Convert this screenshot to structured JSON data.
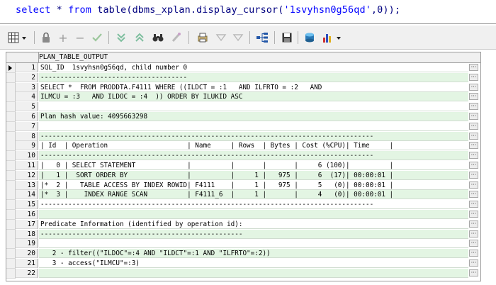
{
  "editor": {
    "kw_select": "select",
    "star": " * ",
    "kw_from": "from",
    "call_prefix": " table(dbms_xplan.display_cursor(",
    "str_sqlid": "'1svyhsn0g56qd'",
    "call_suffix": ",0));"
  },
  "toolbar": {
    "icons": [
      "grid-select-icon",
      "lock-icon",
      "add-icon",
      "remove-icon",
      "post-icon",
      "sort-down-icon",
      "sort-up-icon",
      "find-icon",
      "clear-icon",
      "print-icon",
      "filter-icon",
      "filter-clear-icon",
      "tree-icon",
      "save-icon",
      "database-icon",
      "chart-icon"
    ],
    "colors": {
      "icon_gray": "#7d7d7d",
      "icon_blue": "#2458a8",
      "icon_green": "#3a9a3a"
    }
  },
  "grid": {
    "column_header": "PLAN_TABLE_OUTPUT",
    "more_label": "···",
    "rows": [
      {
        "n": "1",
        "text": "SQL_ID  1svyhsn0g56qd, child number 0"
      },
      {
        "n": "2",
        "text": "-------------------------------------"
      },
      {
        "n": "3",
        "text": "SELECT *  FROM PRODDTA.F4111 WHERE ((ILDCT = :1   AND ILFRTO = :2   AND"
      },
      {
        "n": "4",
        "text": "ILMCU = :3   AND ILDOC = :4  )) ORDER BY ILUKID ASC"
      },
      {
        "n": "5",
        "text": ""
      },
      {
        "n": "6",
        "text": "Plan hash value: 4095663298"
      },
      {
        "n": "7",
        "text": ""
      },
      {
        "n": "8",
        "text": "------------------------------------------------------------------------------------"
      },
      {
        "n": "9",
        "text": "| Id  | Operation                    | Name     | Rows  | Bytes | Cost (%CPU)| Time     |"
      },
      {
        "n": "10",
        "text": "------------------------------------------------------------------------------------"
      },
      {
        "n": "11",
        "text": "|   0 | SELECT STATEMENT             |          |       |       |     6 (100)|          |"
      },
      {
        "n": "12",
        "text": "|   1 |  SORT ORDER BY               |          |     1 |   975 |     6  (17)| 00:00:01 |"
      },
      {
        "n": "13",
        "text": "|*  2 |   TABLE ACCESS BY INDEX ROWID| F4111    |     1 |   975 |     5   (0)| 00:00:01 |"
      },
      {
        "n": "14",
        "text": "|*  3 |    INDEX RANGE SCAN          | F4111_6  |     1 |       |     4   (0)| 00:00:01 |"
      },
      {
        "n": "15",
        "text": "------------------------------------------------------------------------------------"
      },
      {
        "n": "16",
        "text": ""
      },
      {
        "n": "17",
        "text": "Predicate Information (identified by operation id):"
      },
      {
        "n": "18",
        "text": "---------------------------------------------------"
      },
      {
        "n": "19",
        "text": ""
      },
      {
        "n": "20",
        "text": "   2 - filter((\"ILDOC\"=:4 AND \"ILDCT\"=:1 AND \"ILFRTO\"=:2))"
      },
      {
        "n": "21",
        "text": "   3 - access(\"ILMCU\"=:3)"
      },
      {
        "n": "22",
        "text": ""
      }
    ]
  }
}
